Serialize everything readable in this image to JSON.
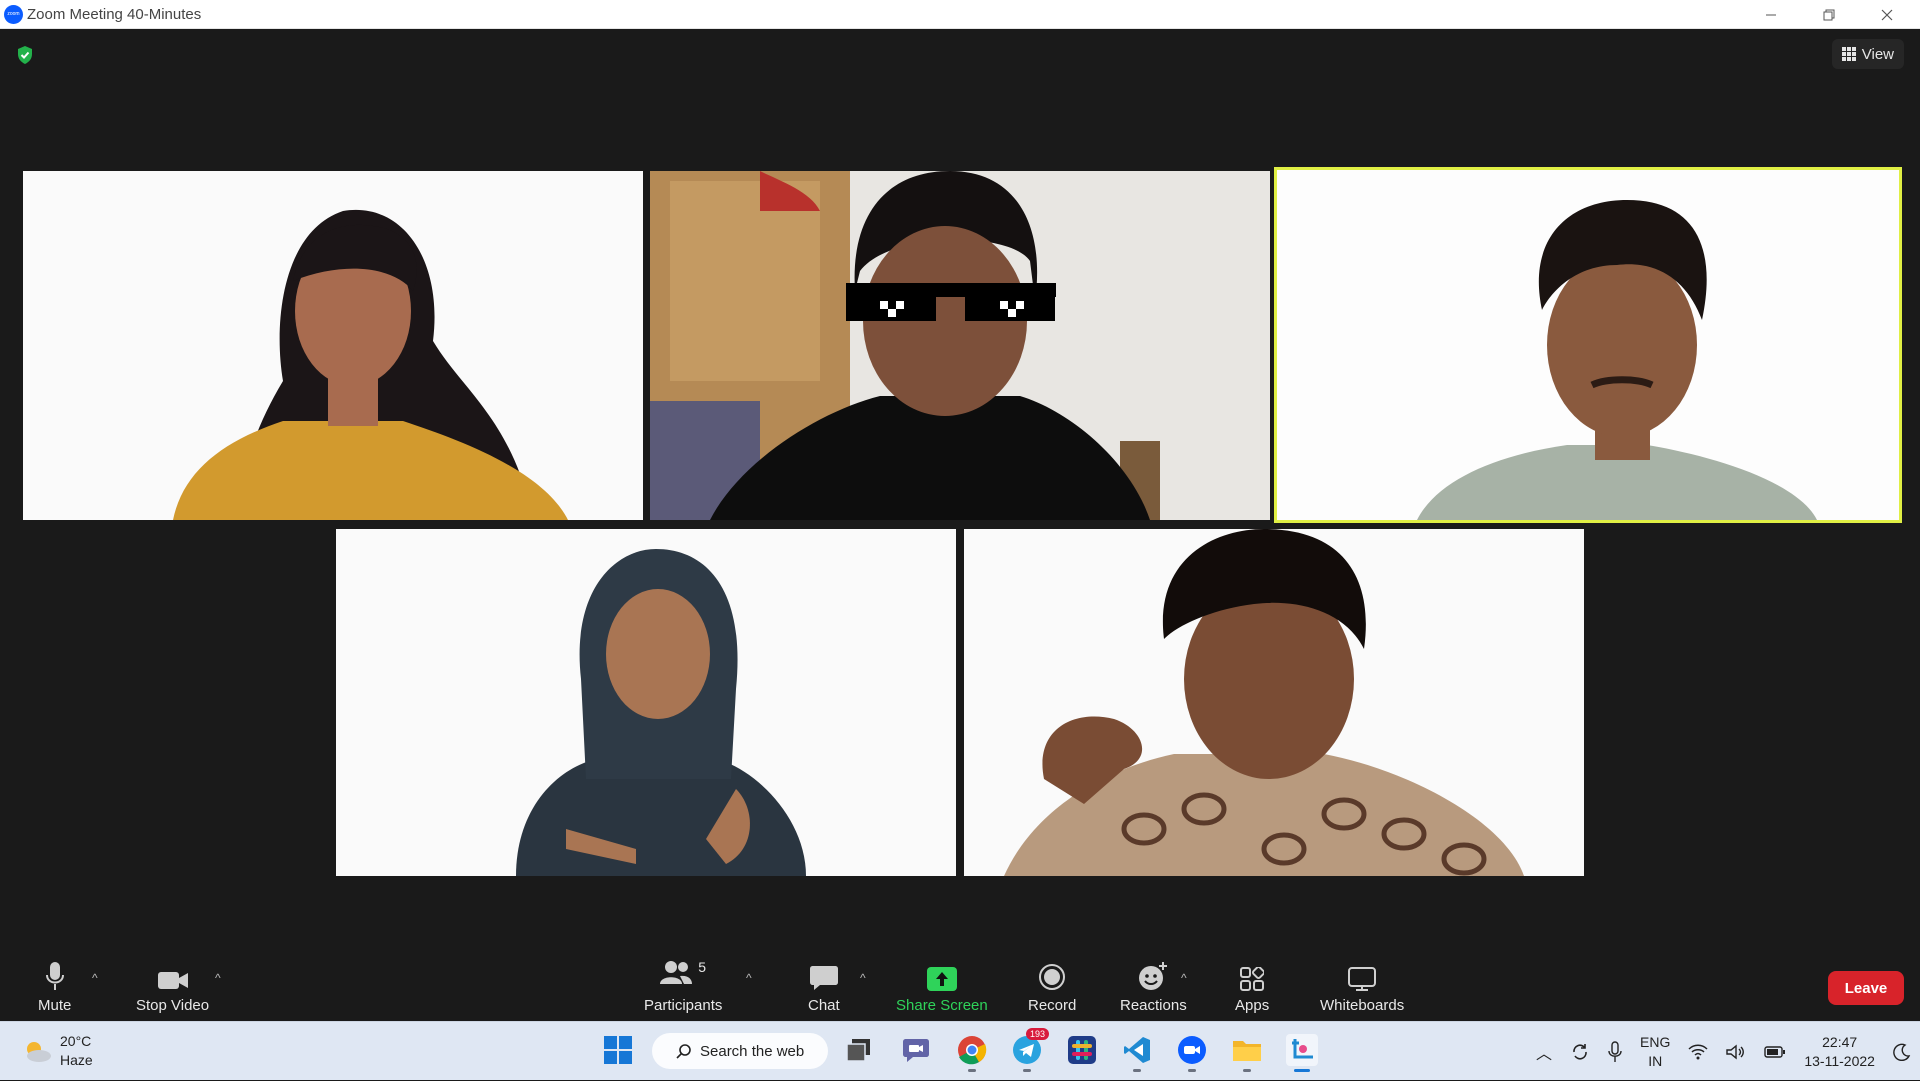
{
  "window": {
    "title": "Zoom Meeting 40-Minutes",
    "logo_text": "zoom"
  },
  "header": {
    "view_label": "View"
  },
  "participants_tiles": [
    {
      "name": "participant-woman-yellow-top"
    },
    {
      "name": "participant-woman-sunglasses"
    },
    {
      "name": "participant-man-active-speaker"
    },
    {
      "name": "participant-man-hoodie"
    },
    {
      "name": "participant-man-patterned-shirt"
    }
  ],
  "toolbar": {
    "mute_label": "Mute",
    "stop_video_label": "Stop Video",
    "participants_label": "Participants",
    "participants_count": "5",
    "chat_label": "Chat",
    "share_screen_label": "Share Screen",
    "record_label": "Record",
    "reactions_label": "Reactions",
    "apps_label": "Apps",
    "whiteboards_label": "Whiteboards",
    "leave_label": "Leave"
  },
  "taskbar": {
    "weather_temp": "20°C",
    "weather_desc": "Haze",
    "search_label": "Search the web",
    "telegram_badge": "193",
    "lang_top": "ENG",
    "lang_bottom": "IN",
    "time": "22:47",
    "date": "13-11-2022"
  },
  "colors": {
    "share_green": "#2fd35a",
    "leave_red": "#d8232a",
    "active_border": "#e0ef44",
    "zoom_blue": "#0b5cff"
  }
}
